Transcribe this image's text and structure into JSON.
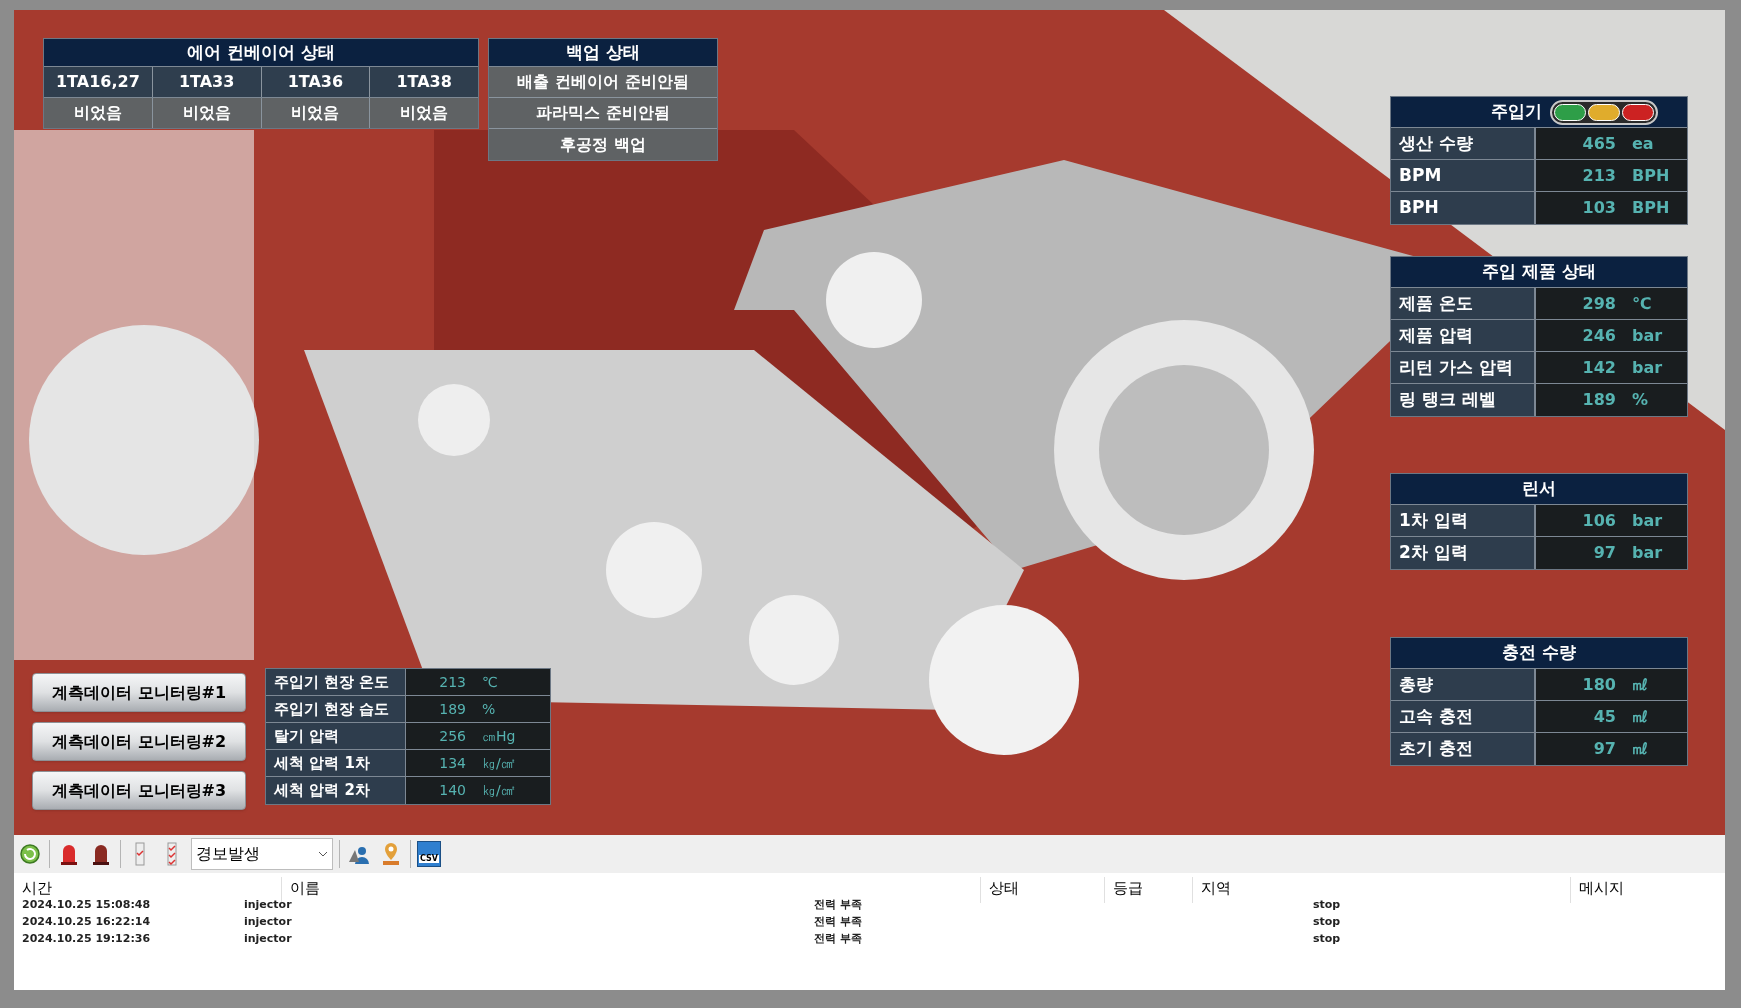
{
  "air_conveyor": {
    "title": "에어 컨베이어 상태",
    "columns": [
      {
        "name": "1TA16,27",
        "status": "비었음"
      },
      {
        "name": "1TA33",
        "status": "비었음"
      },
      {
        "name": "1TA36",
        "status": "비었음"
      },
      {
        "name": "1TA38",
        "status": "비었음"
      }
    ]
  },
  "backup": {
    "title": "백업 상태",
    "items": [
      "배출 컨베이어 준비안됨",
      "파라믹스 준비안됨",
      "후공정 백업"
    ]
  },
  "injector": {
    "title": "주입기",
    "lamps": [
      {
        "color": "#2e9e48"
      },
      {
        "color": "#e0ac2c"
      },
      {
        "color": "#cc2222"
      }
    ],
    "rows": [
      {
        "label": "생산 수량",
        "value": "465",
        "unit": "ea"
      },
      {
        "label": "BPM",
        "value": "213",
        "unit": "BPH"
      },
      {
        "label": "BPH",
        "value": "103",
        "unit": "BPH"
      }
    ]
  },
  "product_status": {
    "title": "주입 제품 상태",
    "rows": [
      {
        "label": "제품 온도",
        "value": "298",
        "unit": "℃"
      },
      {
        "label": "제품 압력",
        "value": "246",
        "unit": "bar"
      },
      {
        "label": "리턴 가스 압력",
        "value": "142",
        "unit": "bar"
      },
      {
        "label": "링 탱크 레벨",
        "value": "189",
        "unit": "%"
      }
    ]
  },
  "rinser": {
    "title": "린서",
    "rows": [
      {
        "label": "1차 입력",
        "value": "106",
        "unit": "bar"
      },
      {
        "label": "2차 입력",
        "value": "97",
        "unit": "bar"
      }
    ]
  },
  "fill_amount": {
    "title": "충전 수량",
    "rows": [
      {
        "label": "총량",
        "value": "180",
        "unit": "㎖"
      },
      {
        "label": "고속 충전",
        "value": "45",
        "unit": "㎖"
      },
      {
        "label": "초기 충전",
        "value": "97",
        "unit": "㎖"
      }
    ]
  },
  "monitoring_buttons": [
    "계측데이터 모니터링#1",
    "계측데이터 모니터링#2",
    "계측데이터 모니터링#3"
  ],
  "field_data": {
    "rows": [
      {
        "label": "주입기 현장 온도",
        "value": "213",
        "unit": "℃"
      },
      {
        "label": "주입기 현장 습도",
        "value": "189",
        "unit": "%"
      },
      {
        "label": "탈기 압력",
        "value": "256",
        "unit": "㎝Hg"
      },
      {
        "label": "세척 압력 1차",
        "value": "134",
        "unit": "㎏/㎠"
      },
      {
        "label": "세척 압력 2차",
        "value": "140",
        "unit": "㎏/㎠"
      }
    ]
  },
  "toolbar": {
    "filter": {
      "value": "경보발생"
    },
    "csv_label": "CSV"
  },
  "alarm_table": {
    "columns": [
      "시간",
      "이름",
      "상태",
      "등급",
      "지역",
      "메시지"
    ],
    "rows": [
      {
        "time": "2024.10.25 15:08:48",
        "name": "injector",
        "column_3": "전력 부족",
        "column_4": "stop"
      },
      {
        "time": "2024.10.25 16:22:14",
        "name": "injector",
        "column_3": "전력 부족",
        "column_4": "stop"
      },
      {
        "time": "2024.10.25 19:12:36",
        "name": "injector",
        "column_3": "전력 부족",
        "column_4": "stop"
      }
    ]
  }
}
